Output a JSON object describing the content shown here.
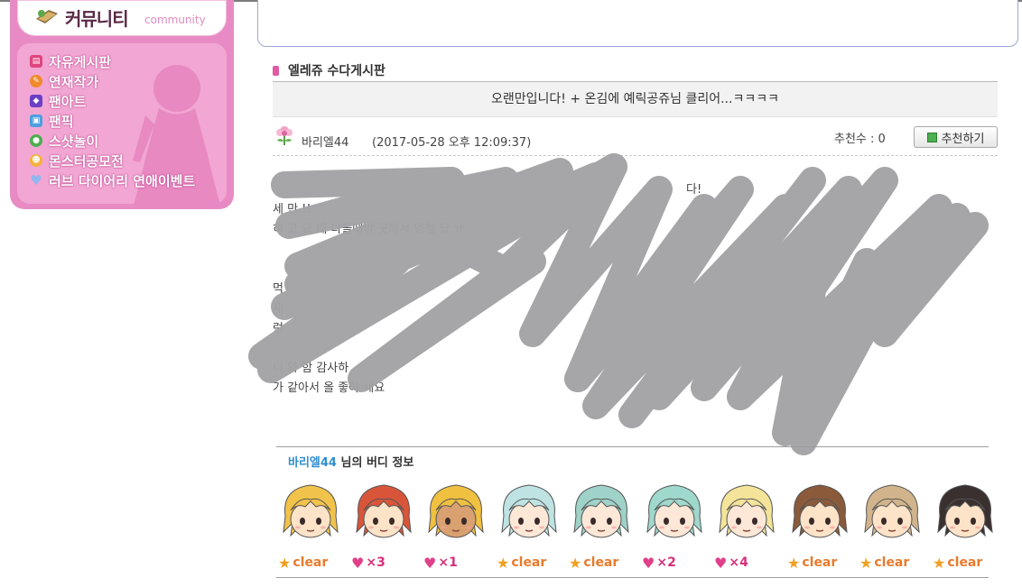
{
  "sidebar": {
    "title": "커뮤니티",
    "subtitle": "community",
    "items": [
      {
        "label": "자유게시판",
        "icon": "board-icon",
        "color": "#e0457f"
      },
      {
        "label": "연재작가",
        "icon": "writer-icon",
        "color": "#f08a2a"
      },
      {
        "label": "팬아트",
        "icon": "gem-icon",
        "color": "#6b3fc6"
      },
      {
        "label": "팬픽",
        "icon": "book-icon",
        "color": "#4d9fe0"
      },
      {
        "label": "스샷놀이",
        "icon": "camera-icon",
        "color": "#4caf50"
      },
      {
        "label": "몬스터공모전",
        "icon": "monster-icon",
        "color": "#f5b23a"
      },
      {
        "label": "러브 다이어리 연애이벤트",
        "icon": "heart-icon",
        "color": "#8fb6f0"
      }
    ]
  },
  "board": {
    "name": "엘레쥬 수다게시판"
  },
  "post": {
    "title": "오랜만입니다! + 온김에 예릭공쥬님 클리어...ㅋㅋㅋㅋ",
    "author": "바리엘44",
    "date": "(2017-05-28 오후 12:09:37)",
    "recommend_count": "추천수 : 0",
    "recommend_button": "추천하기",
    "body_lines": [
      "다!",
      "세                                 만                  !!",
      "히                              고                   요          때 나올때밖              곳해서 엄청 답         ㅠ",
      "                              ",
      "",
      "먹           ",
      "재",
      "                        런                                     ",
      "                             ",
      "                                         니                     와 함        감사하",
      "가              같아서 올         좋아      세요"
    ]
  },
  "buddy": {
    "owner": "바리엘44",
    "suffix": "님의 버디 정보",
    "items": [
      {
        "hair": "#f2c34b",
        "skin": "#fde3c8",
        "badge": "clear",
        "badge_text": "clear"
      },
      {
        "hair": "#d9553a",
        "skin": "#fde3c8",
        "badge": "heart",
        "badge_text": "×3"
      },
      {
        "hair": "#f0c040",
        "skin": "#d9a070",
        "badge": "heart",
        "badge_text": "×1"
      },
      {
        "hair": "#bfe3e3",
        "skin": "#fde8d8",
        "badge": "clear",
        "badge_text": "clear"
      },
      {
        "hair": "#9fd2c8",
        "skin": "#fde8d8",
        "badge": "clear",
        "badge_text": "clear"
      },
      {
        "hair": "#9fd8cc",
        "skin": "#fde8d8",
        "badge": "heart",
        "badge_text": "×2"
      },
      {
        "hair": "#f3e49a",
        "skin": "#fde8d8",
        "badge": "heart",
        "badge_text": "×4"
      },
      {
        "hair": "#8a5a3a",
        "skin": "#fde3c8",
        "badge": "clear",
        "badge_text": "clear"
      },
      {
        "hair": "#d2b48c",
        "skin": "#fde3c8",
        "badge": "clear",
        "badge_text": "clear"
      },
      {
        "hair": "#3a3030",
        "skin": "#fde3c8",
        "badge": "clear",
        "badge_text": "clear"
      }
    ]
  },
  "colors": {
    "sidebar_bg": "#e88bc4",
    "sidebar_panel": "#f2a6d3",
    "accent_pink": "#e05aa6",
    "buddy_name_blue": "#2f8fd0",
    "scribble_gray": "#a3a3a5"
  }
}
